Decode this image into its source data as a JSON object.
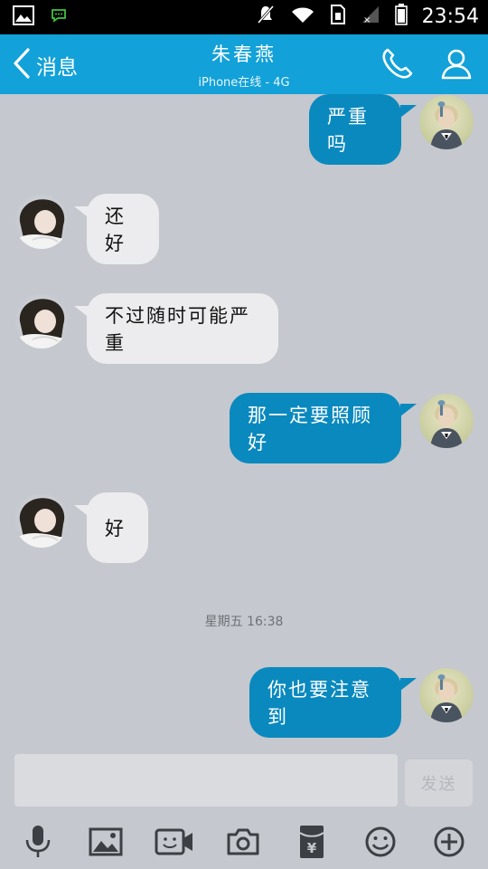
{
  "status_bar": {
    "time": "23:54",
    "icons": [
      "image-icon",
      "chat-notification-icon",
      "mute-icon",
      "wifi-icon",
      "sim-icon",
      "signal-icon",
      "battery-icon"
    ]
  },
  "header": {
    "back_label": "消息",
    "contact_name": "朱春燕",
    "contact_status": "iPhone在线 - 4G",
    "icons": [
      "back-chevron-icon",
      "phone-icon",
      "profile-icon"
    ]
  },
  "messages": [
    {
      "direction": "out",
      "text": "严重吗"
    },
    {
      "direction": "in",
      "text": "还好"
    },
    {
      "direction": "in",
      "text": "不过随时可能严重"
    },
    {
      "direction": "out",
      "text": "那一定要照顾好"
    },
    {
      "direction": "in",
      "text": "好"
    },
    {
      "direction": "out",
      "text": "你也要注意到"
    }
  ],
  "timestamp": "星期五 16:38",
  "composer": {
    "input_value": "",
    "send_label": "发送"
  },
  "toolbar": {
    "icons": [
      "microphone-icon",
      "photo-icon",
      "video-icon",
      "camera-icon",
      "red-packet-icon",
      "emoji-icon",
      "add-icon"
    ]
  },
  "colors": {
    "header": "#12a1d8",
    "outgoing_bubble": "#0a89be",
    "incoming_bubble": "#ececee",
    "background": "#c5c8ce"
  }
}
